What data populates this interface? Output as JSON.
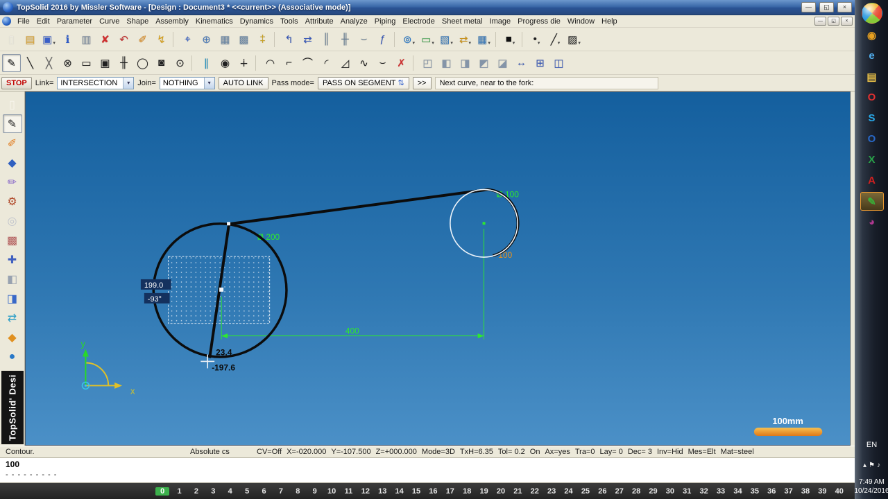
{
  "window": {
    "title": "TopSolid 2016 by Missler Software - [Design : Document3 *  <<current>> (Associative mode)]",
    "controls": {
      "minimize": "—",
      "restore": "◱",
      "close": "×"
    }
  },
  "menu": {
    "items": [
      "File",
      "Edit",
      "Parameter",
      "Curve",
      "Shape",
      "Assembly",
      "Kinematics",
      "Dynamics",
      "Tools",
      "Attribute",
      "Analyze",
      "Piping",
      "Electrode",
      "Sheet metal",
      "Image",
      "Progress die",
      "Window",
      "Help"
    ]
  },
  "toolbar1": {
    "items": [
      {
        "name": "new-document-button",
        "g": "▯",
        "c": "#f8f6ee"
      },
      {
        "name": "open-document-button",
        "g": "▤",
        "c": "#d8a030"
      },
      {
        "name": "save-button",
        "g": "▣",
        "c": "#3a5fc8",
        "cls": "dd"
      },
      {
        "name": "info-document-button",
        "g": "ℹ",
        "c": "#2a58c8"
      },
      {
        "name": "print-button",
        "g": "▥",
        "c": "#78889c"
      },
      {
        "name": "delete-button",
        "g": "✘",
        "c": "#d03030"
      },
      {
        "name": "undo-button",
        "g": "↶",
        "c": "#c43030"
      },
      {
        "name": "edit-pencil-button",
        "g": "✐",
        "c": "#e08a18"
      },
      {
        "name": "magic-wand-button",
        "g": "↯",
        "c": "#d8a018"
      },
      {
        "name": "separator",
        "cls": "sep"
      },
      {
        "name": "compass-button",
        "g": "⌖",
        "c": "#2a58c8"
      },
      {
        "name": "zoom-sheet-button",
        "g": "⊕",
        "c": "#4878b8"
      },
      {
        "name": "hatch-grid-button",
        "g": "▦",
        "c": "#6a86a4"
      },
      {
        "name": "hatch-grid-2-button",
        "g": "▩",
        "c": "#6a86a4"
      },
      {
        "name": "keys-button",
        "g": "‡",
        "c": "#c8a020"
      },
      {
        "name": "separator",
        "cls": "sep"
      },
      {
        "name": "cursor-arrows-button",
        "g": "↰",
        "c": "#3858b8"
      },
      {
        "name": "kinematic-arrows-button",
        "g": "⇄",
        "c": "#3858b8"
      },
      {
        "name": "columns-button",
        "g": "║",
        "c": "#607890"
      },
      {
        "name": "columns-grid-button",
        "g": "╫",
        "c": "#607890"
      },
      {
        "name": "grab-tool-button",
        "g": "⌣",
        "c": "#607890"
      },
      {
        "name": "function-button",
        "g": "ƒ",
        "c": "#3858b8"
      },
      {
        "name": "separator",
        "cls": "sep"
      },
      {
        "name": "view-target-button",
        "g": "⊚",
        "c": "#2878c8",
        "cls": "dd"
      },
      {
        "name": "frame-view-button",
        "g": "▭",
        "c": "#38a048",
        "cls": "dd"
      },
      {
        "name": "layer-box-button",
        "g": "▧",
        "c": "#3878b8",
        "cls": "dd"
      },
      {
        "name": "swap-view-button",
        "g": "⇄",
        "c": "#c89018",
        "cls": "dd"
      },
      {
        "name": "table-view-button",
        "g": "▦",
        "c": "#3878b8",
        "cls": "dd"
      },
      {
        "name": "separator",
        "cls": "sep"
      },
      {
        "name": "color-swatch-button",
        "g": "■",
        "c": "#101010",
        "cls": "dd"
      },
      {
        "name": "separator",
        "cls": "sep"
      },
      {
        "name": "point-style-button",
        "g": "•",
        "c": "#202020",
        "cls": "dd"
      },
      {
        "name": "line-style-button",
        "g": "╱",
        "c": "#202020",
        "cls": "dd"
      },
      {
        "name": "hatch-style-button",
        "g": "▨",
        "c": "#202020",
        "cls": "dd"
      }
    ]
  },
  "toolbar2": {
    "items": [
      {
        "name": "sketch-pencil-button",
        "g": "✎",
        "c": "#202020",
        "cls": "active"
      },
      {
        "name": "line-tool-button",
        "g": "╲",
        "c": "#202020"
      },
      {
        "name": "construction-line-button",
        "g": "╳",
        "c": "#606060"
      },
      {
        "name": "point-on-curve-button",
        "g": "⊗",
        "c": "#202020"
      },
      {
        "name": "rectangle-tool-button",
        "g": "▭",
        "c": "#202020"
      },
      {
        "name": "frame-tool-button",
        "g": "▣",
        "c": "#202020"
      },
      {
        "name": "axis-tool-button",
        "g": "╫",
        "c": "#202020"
      },
      {
        "name": "ellipse-tool-button",
        "g": "◯",
        "c": "#202020"
      },
      {
        "name": "slot-tool-button",
        "g": "◙",
        "c": "#202020"
      },
      {
        "name": "circle-tool-button",
        "g": "⊙",
        "c": "#202020"
      },
      {
        "name": "separator",
        "cls": "sep"
      },
      {
        "name": "parallel-tool-button",
        "g": "∥",
        "c": "#2090c0"
      },
      {
        "name": "point-target-button",
        "g": "◉",
        "c": "#202020"
      },
      {
        "name": "point-tool-button",
        "g": "∔",
        "c": "#202020"
      },
      {
        "name": "separator",
        "cls": "sep"
      },
      {
        "name": "arc-tool-button",
        "g": "◠",
        "c": "#202020"
      },
      {
        "name": "corner-tool-button",
        "g": "⌐",
        "c": "#202020"
      },
      {
        "name": "arc-3pt-button",
        "g": "⌒",
        "c": "#202020"
      },
      {
        "name": "fillet-tool-button",
        "g": "◜",
        "c": "#202020"
      },
      {
        "name": "chamfer-tool-button",
        "g": "◿",
        "c": "#202020"
      },
      {
        "name": "spline-tool-button",
        "g": "∿",
        "c": "#202020"
      },
      {
        "name": "connect-tool-button",
        "g": "⌣",
        "c": "#202020"
      },
      {
        "name": "delete-curve-button",
        "g": "✗",
        "c": "#d03030"
      },
      {
        "name": "separator",
        "cls": "sep"
      },
      {
        "name": "view-front-button",
        "g": "◰",
        "c": "#8494a8"
      },
      {
        "name": "view-iso-1-button",
        "g": "◧",
        "c": "#8494a8"
      },
      {
        "name": "view-iso-2-button",
        "g": "◨",
        "c": "#8494a8"
      },
      {
        "name": "view-iso-3-button",
        "g": "◩",
        "c": "#8494a8"
      },
      {
        "name": "view-iso-4-button",
        "g": "◪",
        "c": "#8494a8"
      },
      {
        "name": "dimension-tool-button",
        "g": "↔",
        "c": "#3858b8"
      },
      {
        "name": "grid-tool-button",
        "g": "⊞",
        "c": "#3858b8"
      },
      {
        "name": "stats-tool-button",
        "g": "◫",
        "c": "#3858b8"
      }
    ]
  },
  "param_bar": {
    "stop_label": "STOP",
    "link_label": "Link=",
    "link_value": "INTERSECTION",
    "join_label": "Join=",
    "join_value": "NOTHING",
    "auto_link_label": "AUTO LINK",
    "pass_mode_label": "Pass mode=",
    "pass_mode_value": "PASS ON SEGMENT",
    "pass_mode_icon": "⇅",
    "more_label": ">>",
    "prompt": "Next curve, near to the fork:",
    "combo_arrow": "▾"
  },
  "left_toolbar": {
    "brand": "TopSolid' Desi",
    "items": [
      {
        "name": "document-tool",
        "g": "▯",
        "c": "#f8f6ee"
      },
      {
        "name": "sketch-tool",
        "g": "✎",
        "c": "#202020",
        "cls": "active"
      },
      {
        "name": "cut-tool",
        "g": "✐",
        "c": "#e07818"
      },
      {
        "name": "solid-tool",
        "g": "◆",
        "c": "#3060c0"
      },
      {
        "name": "shape-pencil-tool",
        "g": "✏",
        "c": "#8868c8"
      },
      {
        "name": "machine-tool",
        "g": "⚙",
        "c": "#b04828"
      },
      {
        "name": "ring-tool",
        "g": "◎",
        "c": "#c0c4cc"
      },
      {
        "name": "palette-tool",
        "g": "▩",
        "c": "#b05858"
      },
      {
        "name": "helper-tool",
        "g": "✚",
        "c": "#4060c0"
      },
      {
        "name": "cube-gray-tool",
        "g": "◧",
        "c": "#98a2b0"
      },
      {
        "name": "cube-blue-tool",
        "g": "◨",
        "c": "#3868c8"
      },
      {
        "name": "transfer-tool",
        "g": "⇄",
        "c": "#30a0c8"
      },
      {
        "name": "wedge-tool",
        "g": "◆",
        "c": "#e09020"
      },
      {
        "name": "sphere-tool",
        "g": "●",
        "c": "#2878c8"
      }
    ]
  },
  "canvas": {
    "dim_dia_small": "Ø 100",
    "dim_dia_large": "Ø 200",
    "dim_width": "400",
    "dim_height": "100",
    "tip_length": "199.0",
    "tip_angle": "-93°",
    "cursor_x": "23.4",
    "cursor_y": "-197.6",
    "axis_x": "x",
    "axis_y": "y",
    "scale_label": "100mm",
    "colors": {
      "dimension_green": "#2ee82e",
      "highlight_orange": "#e8921e",
      "curve_black": "#0c0c0c",
      "selected_white": "#eef4fa"
    }
  },
  "status_bar": {
    "mode": "Contour.",
    "cs": "Absolute cs",
    "fields": [
      "CV=Off",
      "X=-020.000",
      "Y=-107.500",
      "Z=+000.000",
      "Mode=3D",
      "TxH=6.35",
      "Tol= 0.2",
      "On",
      "Ax=yes",
      "Tra=0",
      "Lay= 0",
      "Dec= 3",
      "Inv=Hid",
      "Mes=Elt",
      "Mat=steel"
    ]
  },
  "command": {
    "value": "100",
    "separator": "- - - - - - - - -"
  },
  "page_bar": {
    "active": "0",
    "numbers": [
      "0",
      "1",
      "2",
      "3",
      "4",
      "5",
      "6",
      "7",
      "8",
      "9",
      "10",
      "11",
      "12",
      "13",
      "14",
      "15",
      "16",
      "17",
      "18",
      "19",
      "20",
      "21",
      "22",
      "23",
      "24",
      "25",
      "26",
      "27",
      "28",
      "29",
      "30",
      "31",
      "32",
      "33",
      "34",
      "35",
      "36",
      "37",
      "38",
      "39",
      "40"
    ]
  },
  "taskbar": {
    "icons": [
      {
        "name": "start-button",
        "g": "",
        "c": "#ffffff",
        "cls": "orb"
      },
      {
        "name": "chrome-icon",
        "g": "◉",
        "c": "#e8a020"
      },
      {
        "name": "internet-explorer-icon",
        "g": "e",
        "c": "#52b0f0"
      },
      {
        "name": "file-explorer-icon",
        "g": "▤",
        "c": "#e8c048"
      },
      {
        "name": "opera-icon",
        "g": "O",
        "c": "#e03030"
      },
      {
        "name": "skype-icon",
        "g": "S",
        "c": "#28a8e8"
      },
      {
        "name": "outlook-icon",
        "g": "O",
        "c": "#2868c8"
      },
      {
        "name": "excel-icon",
        "g": "X",
        "c": "#28a048"
      },
      {
        "name": "pdf-reader-icon",
        "g": "A",
        "c": "#d02020"
      },
      {
        "name": "topsolid-app-icon",
        "g": "✎",
        "c": "#38b038",
        "cls": "active"
      },
      {
        "name": "media-player-icon",
        "g": "◕",
        "c": "#b03890"
      }
    ],
    "lang": "EN",
    "tray": [
      {
        "name": "hidden-icons-button",
        "g": "▴"
      },
      {
        "name": "action-center-icon",
        "g": "⚑"
      },
      {
        "name": "volume-icon",
        "g": "♪"
      }
    ],
    "time": "7:49 AM",
    "date": "10/24/2016"
  }
}
